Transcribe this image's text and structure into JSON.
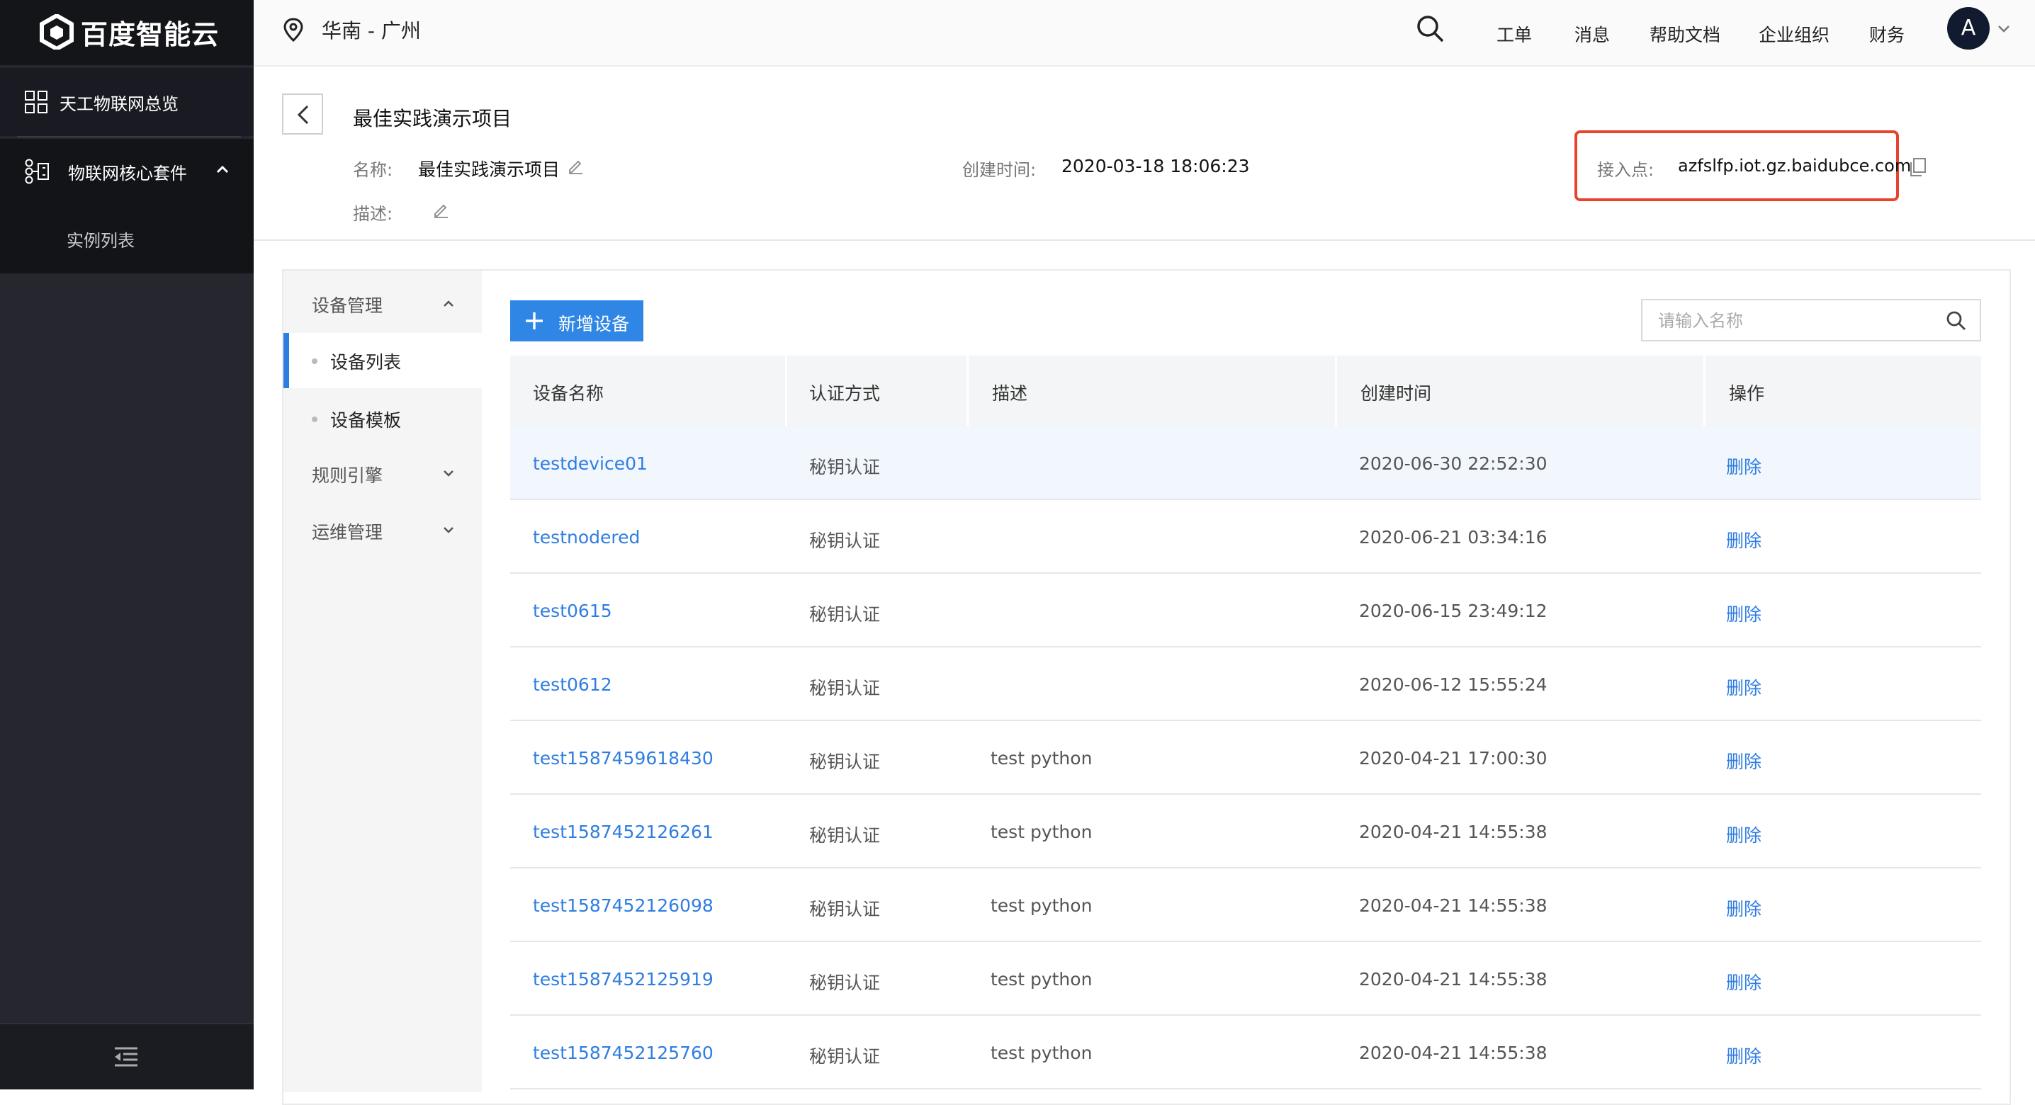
{
  "brand": {
    "name": "百度智能云"
  },
  "sidebar": {
    "overview": "天工物联网总览",
    "core_suite": "物联网核心套件",
    "instances": "实例列表"
  },
  "topbar": {
    "region": "华南 - 广州",
    "nav": [
      "工单",
      "消息",
      "帮助文档",
      "企业组织",
      "财务"
    ],
    "avatar_letter": "A"
  },
  "project": {
    "title": "最佳实践演示项目",
    "name_label": "名称:",
    "name_value": "最佳实践演示项目",
    "desc_label": "描述:",
    "created_label": "创建时间:",
    "created_value": "2020-03-18 18:06:23",
    "endpoint_label": "接入点:",
    "endpoint_value": "azfslfp.iot.gz.baidubce.com"
  },
  "leftnav": {
    "device_mgmt": "设备管理",
    "device_list": "设备列表",
    "device_template": "设备模板",
    "rule_engine": "规则引擎",
    "ops_mgmt": "运维管理"
  },
  "toolbar": {
    "add_label": "新增设备",
    "search_placeholder": "请输入名称"
  },
  "table": {
    "columns": [
      "设备名称",
      "认证方式",
      "描述",
      "创建时间",
      "操作"
    ],
    "rows": [
      {
        "name": "testdevice01",
        "auth": "秘钥认证",
        "desc": "",
        "created": "2020-06-30 22:52:30",
        "action": "删除"
      },
      {
        "name": "testnodered",
        "auth": "秘钥认证",
        "desc": "",
        "created": "2020-06-21 03:34:16",
        "action": "删除"
      },
      {
        "name": "test0615",
        "auth": "秘钥认证",
        "desc": "",
        "created": "2020-06-15 23:49:12",
        "action": "删除"
      },
      {
        "name": "test0612",
        "auth": "秘钥认证",
        "desc": "",
        "created": "2020-06-12 15:55:24",
        "action": "删除"
      },
      {
        "name": "test1587459618430",
        "auth": "秘钥认证",
        "desc": "test python",
        "created": "2020-04-21 17:00:30",
        "action": "删除"
      },
      {
        "name": "test1587452126261",
        "auth": "秘钥认证",
        "desc": "test python",
        "created": "2020-04-21 14:55:38",
        "action": "删除"
      },
      {
        "name": "test1587452126098",
        "auth": "秘钥认证",
        "desc": "test python",
        "created": "2020-04-21 14:55:38",
        "action": "删除"
      },
      {
        "name": "test1587452125919",
        "auth": "秘钥认证",
        "desc": "test python",
        "created": "2020-04-21 14:55:38",
        "action": "删除"
      },
      {
        "name": "test1587452125760",
        "auth": "秘钥认证",
        "desc": "test python",
        "created": "2020-04-21 14:55:38",
        "action": "删除"
      }
    ]
  },
  "colors": {
    "accent": "#2f7de1",
    "highlight_border": "#e8432d",
    "sidebar_bg": "#25262e"
  }
}
